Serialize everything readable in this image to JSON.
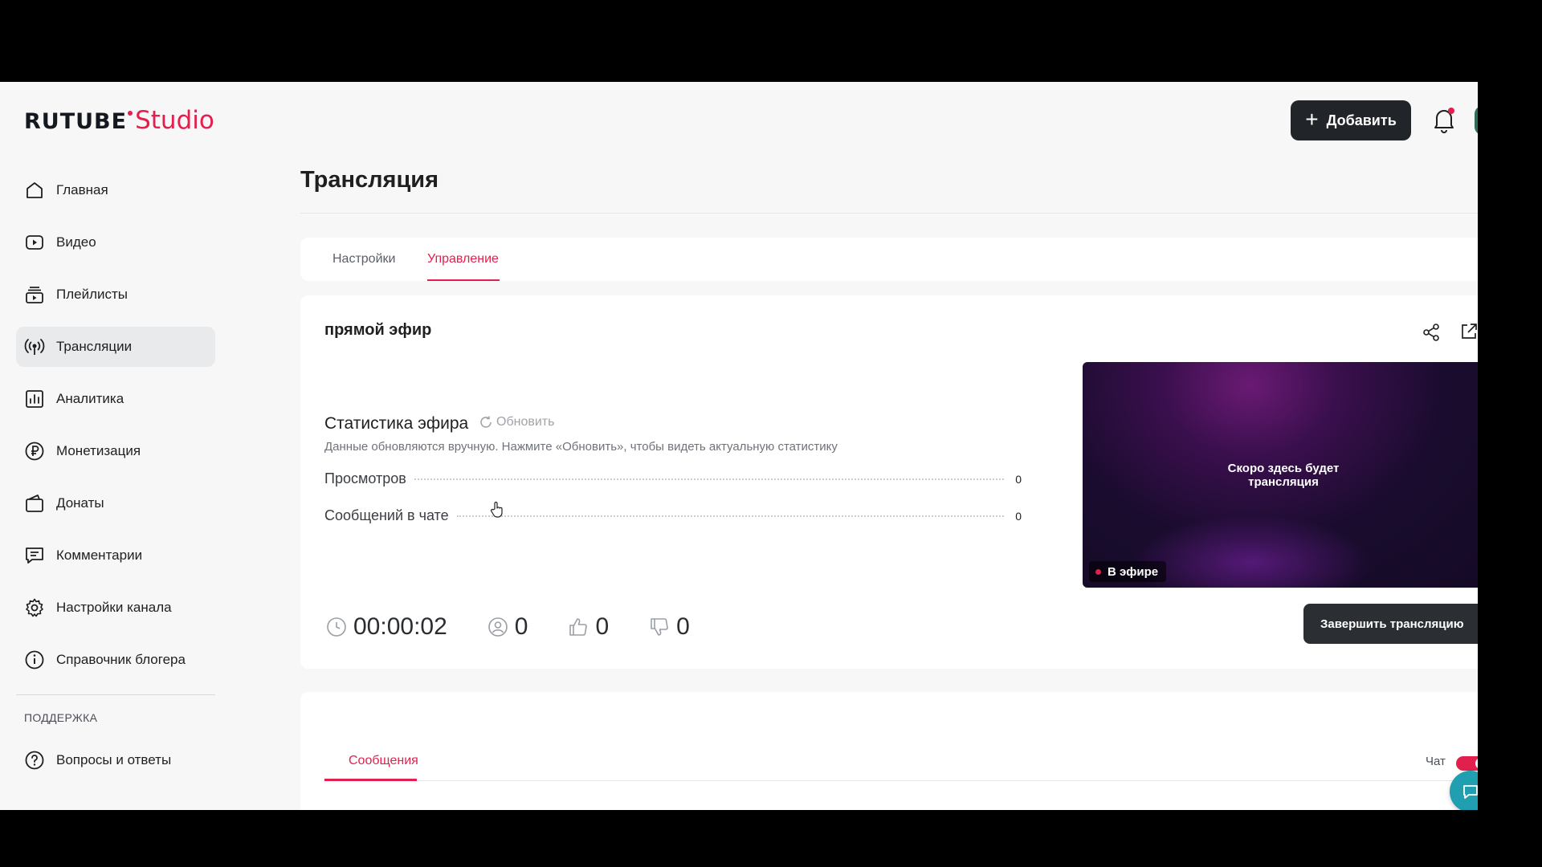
{
  "logo": {
    "brand": "RUTUBE",
    "product": "Studio"
  },
  "header": {
    "add_label": "Добавить"
  },
  "sidebar": {
    "items": [
      {
        "label": "Главная",
        "icon": "home-icon"
      },
      {
        "label": "Видео",
        "icon": "video-icon"
      },
      {
        "label": "Плейлисты",
        "icon": "playlist-icon"
      },
      {
        "label": "Трансляции",
        "icon": "broadcast-icon",
        "active": true
      },
      {
        "label": "Аналитика",
        "icon": "analytics-icon"
      },
      {
        "label": "Монетизация",
        "icon": "ruble-icon"
      },
      {
        "label": "Донаты",
        "icon": "wallet-icon"
      },
      {
        "label": "Комментарии",
        "icon": "comment-icon"
      },
      {
        "label": "Настройки канала",
        "icon": "gear-icon"
      },
      {
        "label": "Справочник блогера",
        "icon": "info-icon"
      }
    ],
    "support_title": "ПОДДЕРЖКА",
    "support_items": [
      {
        "label": "Вопросы и ответы",
        "icon": "question-icon"
      }
    ]
  },
  "main": {
    "title": "Трансляция",
    "tabs": [
      {
        "label": "Настройки"
      },
      {
        "label": "Управление",
        "active": true
      }
    ],
    "stream_name": "прямой эфир",
    "stats": {
      "title": "Статистика эфира",
      "refresh_label": "Обновить",
      "note": "Данные обновляются вручную. Нажмите «Обновить», чтобы видеть актуальную статистику",
      "rows": [
        {
          "label": "Просмотров",
          "value": "0"
        },
        {
          "label": "Сообщений в чате",
          "value": "0"
        }
      ]
    },
    "bottom": {
      "duration": "00:00:02",
      "viewers": "0",
      "likes": "0",
      "dislikes": "0"
    },
    "preview": {
      "placeholder": "Скоро здесь будет трансляция",
      "live_label": "В эфире"
    },
    "end_button": "Завершить трансляцию"
  },
  "messages": {
    "tab_label": "Сообщения",
    "chat_label": "Чат",
    "chat_enabled": true
  },
  "colors": {
    "accent": "#e2204d",
    "dark_button": "#212529",
    "page_bg": "#f7f7f8"
  }
}
